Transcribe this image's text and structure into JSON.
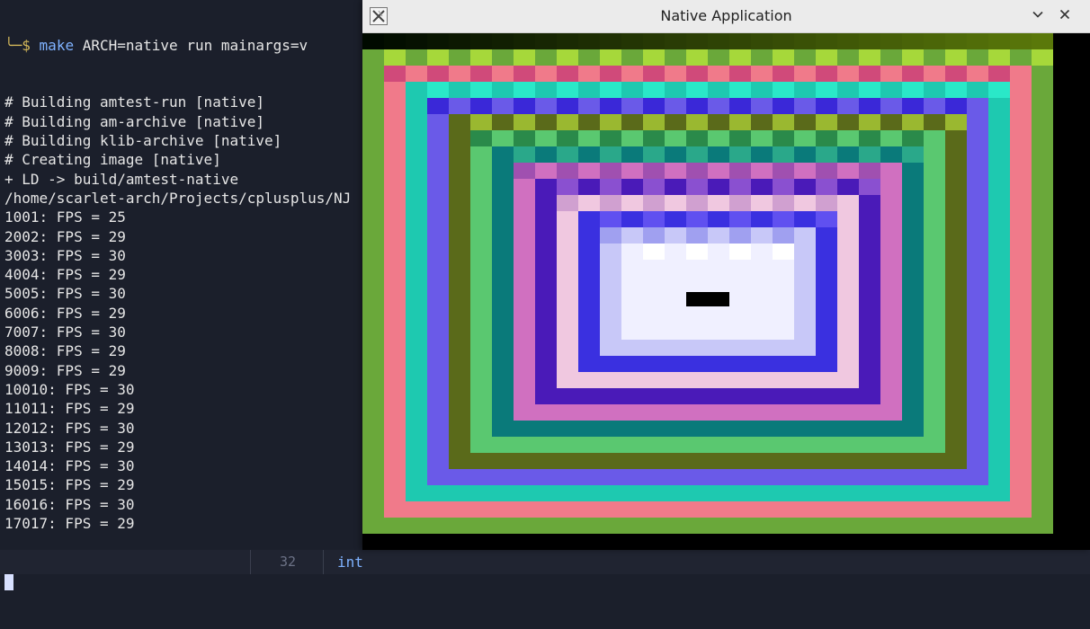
{
  "terminal": {
    "prompt_symbol": "╰─$",
    "command_word": "make",
    "command_args": "ARCH=native run mainargs=v",
    "output_lines": [
      "# Building amtest-run [native]",
      "# Building am-archive [native]",
      "# Building klib-archive [native]",
      "# Creating image [native]",
      "+ LD -> build/amtest-native",
      "/home/scarlet-arch/Projects/cplusplus/NJ",
      "1001: FPS = 25",
      "2002: FPS = 29",
      "3003: FPS = 30",
      "4004: FPS = 29",
      "5005: FPS = 30",
      "6006: FPS = 29",
      "7007: FPS = 30",
      "8008: FPS = 29",
      "9009: FPS = 29",
      "10010: FPS = 30",
      "11011: FPS = 29",
      "12012: FPS = 30",
      "13013: FPS = 29",
      "14014: FPS = 30",
      "15015: FPS = 29",
      "16016: FPS = 30",
      "17017: FPS = 29"
    ]
  },
  "editor": {
    "line_number": "32",
    "code_fragment": "int"
  },
  "window": {
    "title": "Native Application",
    "minimize_icon": "chevron-down-icon",
    "close_icon": "close-icon",
    "app_icon": "x-logo-icon"
  },
  "colors": {
    "terminal_bg": "#1b1f2b",
    "prompt": "#d4b85a",
    "command": "#7fb2ff",
    "titlebar_bg": "#ebebeb"
  }
}
